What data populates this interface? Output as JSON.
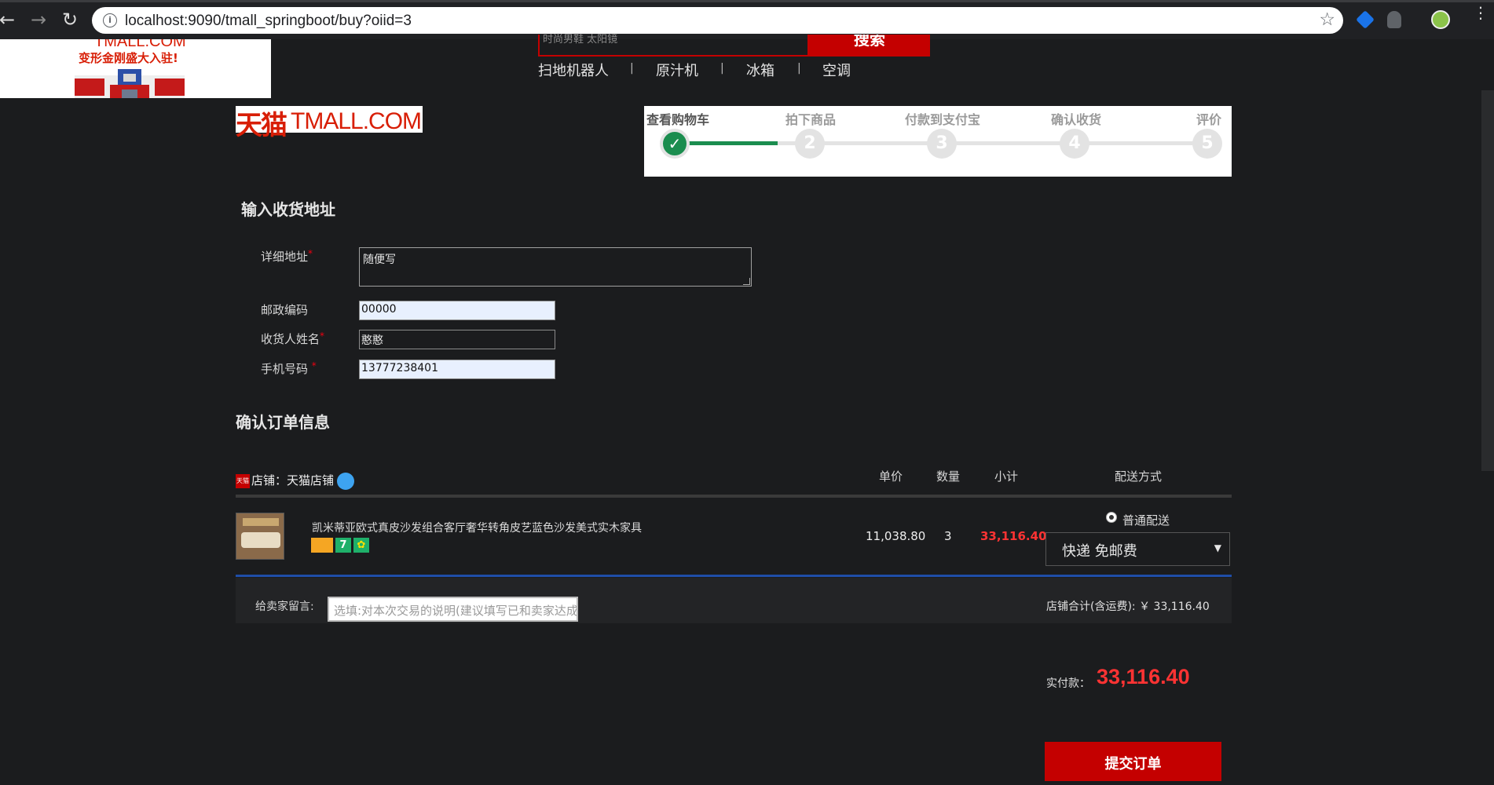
{
  "browser": {
    "url": "localhost:9090/tmall_springboot/buy?oiid=3"
  },
  "ad": {
    "line1": "TMALL.COM",
    "line2": "变形金刚盛大入驻!"
  },
  "search": {
    "placeholder": "时尚男鞋  太阳镜",
    "button_label": "搜索",
    "hot_links": [
      "扫地机器人",
      "原汁机",
      "冰箱",
      "空调"
    ],
    "separator": "|"
  },
  "logo": {
    "cn": "天猫",
    "en": "TMALL.COM"
  },
  "steps": [
    {
      "label": "查看购物车",
      "mark": "✓"
    },
    {
      "label": "拍下商品",
      "mark": "2"
    },
    {
      "label": "付款到支付宝",
      "mark": "3"
    },
    {
      "label": "确认收货",
      "mark": "4"
    },
    {
      "label": "评价",
      "mark": "5"
    }
  ],
  "address": {
    "title": "输入收货地址",
    "required_mark": "*",
    "detail_label": "详细地址",
    "detail_value": "随便写",
    "zip_label": "邮政编码",
    "zip_value": "00000",
    "name_label": "收货人姓名",
    "name_value": "憨憨",
    "phone_label": "手机号码",
    "phone_value": "13777238401"
  },
  "order": {
    "title": "确认订单信息",
    "shop_tag": "天猫",
    "shop_name": "店铺：天猫店铺",
    "columns": {
      "unit_price": "单价",
      "quantity": "数量",
      "subtotal": "小计",
      "delivery": "配送方式"
    },
    "item": {
      "name": "凯米蒂亚欧式真皮沙发组合客厅奢华转角皮艺蓝色沙发美式实木家具",
      "badge_seven": "7",
      "unit_price": "11,038.80",
      "quantity": "3",
      "subtotal": "33,116.40"
    },
    "delivery": {
      "radio_label": "普通配送",
      "selected": "快递 免邮费"
    },
    "message_label": "给卖家留言:",
    "message_placeholder": "选填:对本次交易的说明(建议填写已和卖家达成一致的说明)",
    "shop_total_label": "店铺合计(含运费):",
    "currency": "￥",
    "shop_total": "33,116.40",
    "pay_label": "实付款：",
    "pay_amount": "33,116.40",
    "submit_label": "提交订单"
  },
  "colors": {
    "brand_red": "#c40000",
    "price_red": "#ff3333",
    "step_green": "#1b8d4f",
    "divider_blue": "#1f4ea8"
  }
}
